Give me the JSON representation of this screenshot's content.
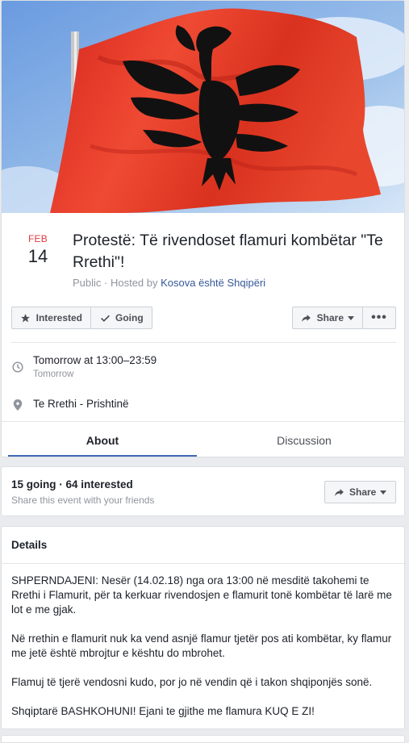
{
  "event": {
    "month": "FEB",
    "day": "14",
    "title": "Protestë: Të rivendoset flamuri kombëtar \"Te Rrethi\"!",
    "privacy": "Public · Hosted by ",
    "host": "Kosova është Shqipëri"
  },
  "actions": {
    "interested_label": "Interested",
    "going_label": "Going",
    "share_label": "Share",
    "more_label": "•••"
  },
  "time": {
    "main": "Tomorrow at 13:00–23:59",
    "sub": "Tomorrow"
  },
  "location": {
    "name": "Te Rrethi - Prishtinë"
  },
  "tabs": [
    {
      "label": "About",
      "active": true
    },
    {
      "label": "Discussion",
      "active": false
    }
  ],
  "stats": {
    "summary": "15 going · 64 interested",
    "sub": "Share this event with your friends",
    "share_label": "Share"
  },
  "details": {
    "heading": "Details",
    "paragraphs": [
      "SHPERNDAJENI: Nesër (14.02.18) nga ora 13:00 në mesditë takohemi te Rrethi i Flamurit, për ta kerkuar rivendosjen e flamurit tonë kombëtar të larë me lot e me gjak.",
      "Në rrethin e flamurit nuk ka vend asnjë flamur tjetër pos ati kombëtar, ky flamur me jetë është mbrojtur e kështu do mbrohet.",
      "Flamuj të tjerë vendosni kudo, por jo në vendin që i takon shqiponjës sonë.",
      "Shqiptarë BASHKOHUNI! Ejani te gjithe me flamura KUQ E ZI!"
    ]
  },
  "colors": {
    "accent": "#4267b2",
    "date_red": "#e0393e",
    "link": "#365899",
    "flag_red": "#e5322b"
  },
  "icons": {
    "interested": "star-icon",
    "going": "check-icon",
    "share": "share-arrow-icon",
    "time": "clock-icon",
    "location": "pin-icon"
  }
}
